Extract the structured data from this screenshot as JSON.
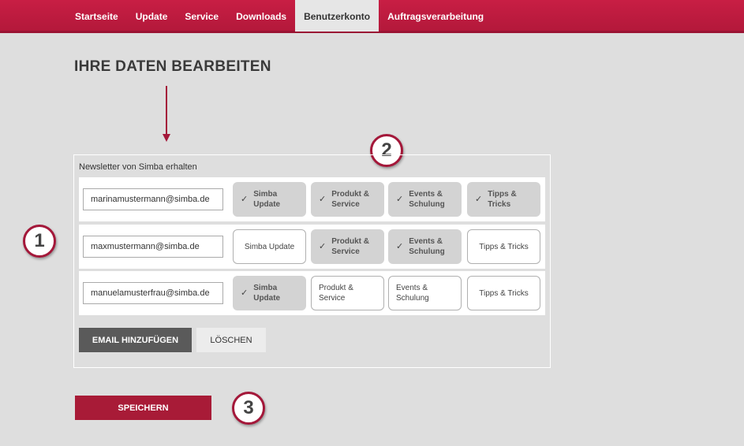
{
  "nav": {
    "items": [
      {
        "label": "Startseite",
        "active": false
      },
      {
        "label": "Update",
        "active": false
      },
      {
        "label": "Service",
        "active": false
      },
      {
        "label": "Downloads",
        "active": false
      },
      {
        "label": "Benutzerkonto",
        "active": true
      },
      {
        "label": "Auftragsverarbeitung",
        "active": false
      }
    ]
  },
  "page_title": "IHRE DATEN BEARBEITEN",
  "annotations": {
    "c1": "1",
    "c2": "2",
    "c3": "3"
  },
  "newsletter": {
    "label": "Newsletter von Simba erhalten",
    "check_glyph": "✓",
    "rows": [
      {
        "email": "marinamustermann@simba.de",
        "tags": [
          {
            "label": "Simba\nUpdate",
            "selected": true
          },
          {
            "label": "Produkt &\nService",
            "selected": true
          },
          {
            "label": "Events &\nSchulung",
            "selected": true
          },
          {
            "label": "Tipps &\nTricks",
            "selected": true
          }
        ]
      },
      {
        "email": "maxmustermann@simba.de",
        "tags": [
          {
            "label": "Simba Update",
            "selected": false
          },
          {
            "label": "Produkt &\nService",
            "selected": true
          },
          {
            "label": "Events &\nSchulung",
            "selected": true
          },
          {
            "label": "Tipps & Tricks",
            "selected": false
          }
        ]
      },
      {
        "email": "manuelamusterfrau@simba.de",
        "tags": [
          {
            "label": "Simba\nUpdate",
            "selected": true
          },
          {
            "label": "Produkt &\nService",
            "selected": false
          },
          {
            "label": "Events &\nSchulung",
            "selected": false
          },
          {
            "label": "Tipps & Tricks",
            "selected": false
          }
        ]
      }
    ],
    "add_button": "EMAIL HINZUFÜGEN",
    "delete_button": "LÖSCHEN"
  },
  "save_button": "SPEICHERN",
  "colors": {
    "brand": "#b2183a",
    "selected_tag": "#d3d3d3",
    "add_button": "#5a5a5a",
    "save_button": "#a81b37"
  }
}
